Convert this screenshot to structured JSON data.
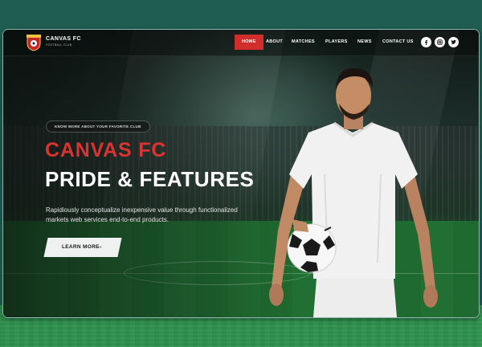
{
  "brand": {
    "name": "CANVAS FC",
    "tagline": "FOOTBALL CLUB"
  },
  "nav": {
    "items": [
      {
        "label": "HOME",
        "active": true
      },
      {
        "label": "ABOUT",
        "active": false
      },
      {
        "label": "MATCHES",
        "active": false
      },
      {
        "label": "PLAYERS",
        "active": false
      },
      {
        "label": "NEWS",
        "active": false
      },
      {
        "label": "CONTACT US",
        "active": false
      }
    ],
    "social": [
      "facebook-icon",
      "instagram-icon",
      "twitter-icon"
    ]
  },
  "hero": {
    "pill": "KNOW MORE ABOUT YOUR FAVORITE CLUB",
    "title_line1": "CANVAS FC",
    "title_line2": "PRIDE & FEATURES",
    "description": "Rapidiously conceptualize inexpensive value through functionalized markets web services end-to-end products.",
    "cta_label": "LEARN MORE",
    "cta_icon": "arrow-right-icon"
  },
  "colors": {
    "accent": "#d12d2b",
    "title_red": "#d9342f",
    "backdrop": "#1f5d52"
  }
}
